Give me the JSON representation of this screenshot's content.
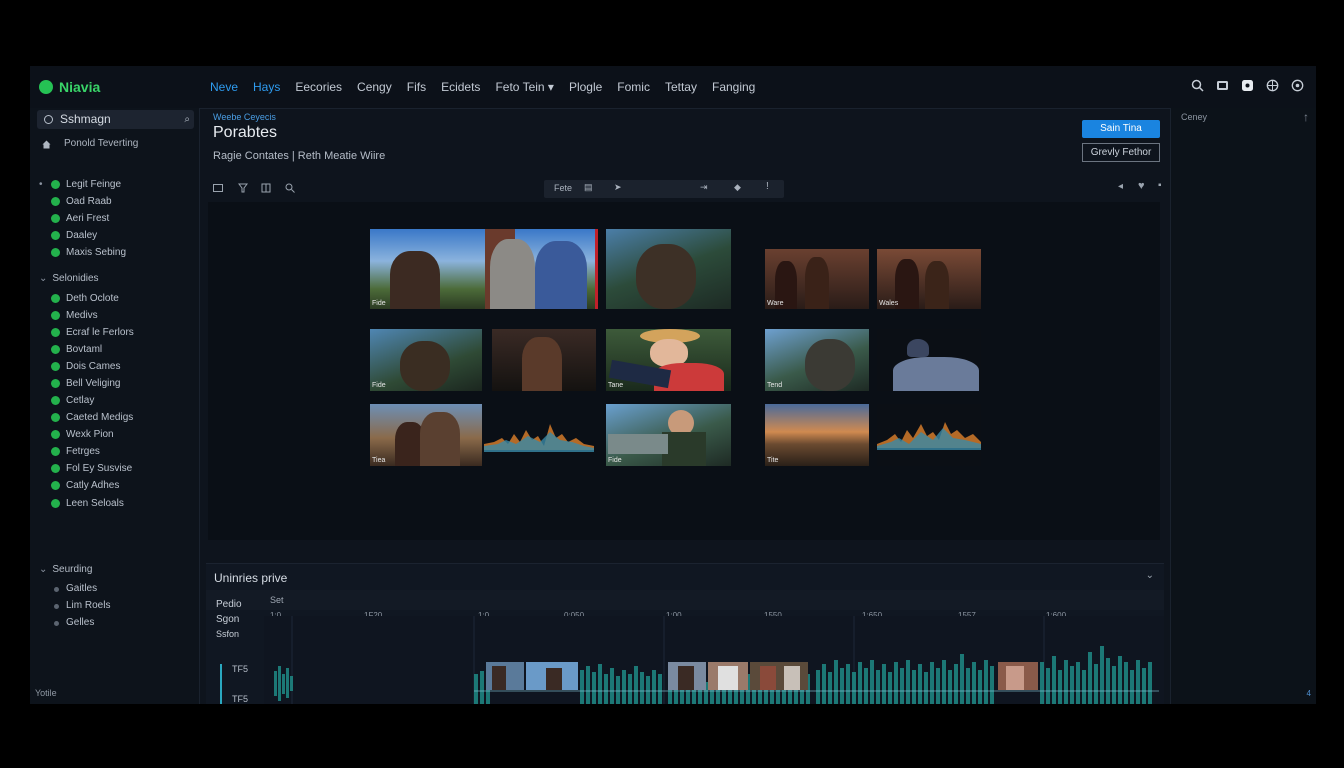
{
  "app": {
    "name": "Niavia"
  },
  "topnav": [
    {
      "label": "Neve",
      "active": true
    },
    {
      "label": "Hays",
      "active": true
    },
    {
      "label": "Eecories",
      "active": false
    },
    {
      "label": "Cengy",
      "active": false
    },
    {
      "label": "Fifs",
      "active": false
    },
    {
      "label": "Ecidets",
      "active": false
    },
    {
      "label": "Feto Tein ▾",
      "active": false
    },
    {
      "label": "Plogle",
      "active": false
    },
    {
      "label": "Fomic",
      "active": false
    },
    {
      "label": "Tettay",
      "active": false
    },
    {
      "label": "Fanging",
      "active": false
    }
  ],
  "topicons": [
    "search-icon",
    "image-icon",
    "shield-icon",
    "globe-icon",
    "settings-icon"
  ],
  "sidebar": {
    "search_text": "Sshmagn",
    "recent_label": "Ponold Teverting",
    "group1": {
      "items": [
        "Legit Feinge",
        "Oad Raab",
        "Aeri Frest",
        "Daaley",
        "Maxis Sebing"
      ]
    },
    "group2": {
      "title": "Selonidies",
      "items": [
        "Deth Oclote",
        "Medivs",
        "Ecraf le Ferlors",
        "Bovtaml",
        "Dois Cames",
        "Bell Veliging",
        "Cetlay",
        "Caeted Medigs",
        "Wexk Pion",
        "Fetrges",
        "Fol Ey Susvise",
        "Catly Adhes",
        "Leen Seloals"
      ]
    },
    "group3": {
      "title": "Seurding",
      "items": [
        "Gaitles",
        "Lim Roels",
        "Gelles"
      ]
    },
    "footer": "Yotile"
  },
  "main": {
    "breadcrumb": "Weebe Ceyecis",
    "title": "Porabtes",
    "subtitle": "Ragie Contates | Reth Meatie Wiire",
    "primary_button": "Sain Tina",
    "secondary_button": "Grevly Fethor",
    "toolbar_mid_label": "Fete",
    "thumbnails": [
      {
        "label": "Fide"
      },
      {
        "label": ""
      },
      {
        "label": "Ware"
      },
      {
        "label": "Wales"
      },
      {
        "label": "Fide"
      },
      {
        "label": ""
      },
      {
        "label": "Tane"
      },
      {
        "label": "Tend"
      },
      {
        "label": ""
      },
      {
        "label": "Tiea"
      },
      {
        "label": ""
      },
      {
        "label": "Fide"
      },
      {
        "label": "Tite"
      },
      {
        "label": ""
      }
    ]
  },
  "timeline": {
    "title": "Uninries prive",
    "left_labels": [
      "Pedio",
      "Sgon",
      "Ssfon"
    ],
    "set_label": "Set",
    "ticks": [
      "1:0",
      "1F20",
      "1:0",
      "0:050",
      "1:00",
      "1550",
      "1:650",
      "1557",
      "1:600"
    ],
    "track_labels": [
      "TF5",
      "TF5"
    ]
  },
  "right_panel": {
    "title": "Ceney",
    "footer": "4"
  }
}
